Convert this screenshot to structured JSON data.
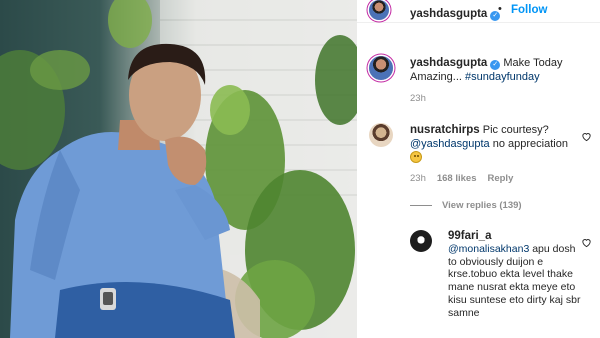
{
  "header": {
    "username": "yashdasgupta",
    "separator": "•",
    "follow_label": "Follow"
  },
  "caption": {
    "username": "yashdasgupta",
    "text": "Make Today Amazing...",
    "hashtag": "#sundayfunday",
    "time": "23h"
  },
  "comments": [
    {
      "username": "nusratchirps",
      "text_before": "Pic courtesy?",
      "mention": "@yashdasgupta",
      "text_after": "no appreciation",
      "time": "23h",
      "likes": "168 likes",
      "reply_label": "Reply",
      "view_replies": "View replies (139)"
    }
  ],
  "replies": [
    {
      "username": "99fari_a",
      "mention": "@monalisakhan3",
      "text": "apu dosh to obviously duijon e krse.tobuo ekta level thake mane nusrat ekta meye eto kisu suntese eto dirty kaj sbr samne"
    }
  ],
  "icons": {
    "verified": "verified-badge-icon",
    "like": "heart-outline-icon",
    "emoji": "disappointed-face-emoji"
  },
  "colors": {
    "link": "#00376b",
    "follow": "#0095f6",
    "verified": "#3897f0",
    "muted": "#8e8e8e"
  }
}
